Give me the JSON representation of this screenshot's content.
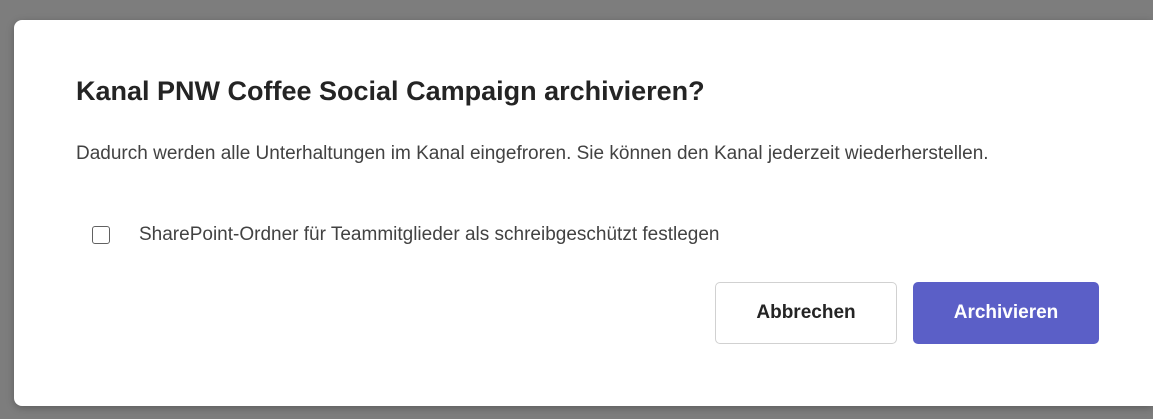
{
  "dialog": {
    "title": "Kanal PNW Coffee Social Campaign archivieren?",
    "description": "Dadurch werden alle Unterhaltungen im Kanal eingefroren. Sie können den Kanal jederzeit wiederherstellen.",
    "checkbox": {
      "label": "SharePoint-Ordner für Teammitglieder als schreibgeschützt festlegen",
      "checked": false
    },
    "buttons": {
      "cancel_label": "Abbrechen",
      "confirm_label": "Archivieren"
    }
  },
  "colors": {
    "primary": "#5b5fc7",
    "backdrop": "#7d7d7d",
    "text": "#242424"
  }
}
